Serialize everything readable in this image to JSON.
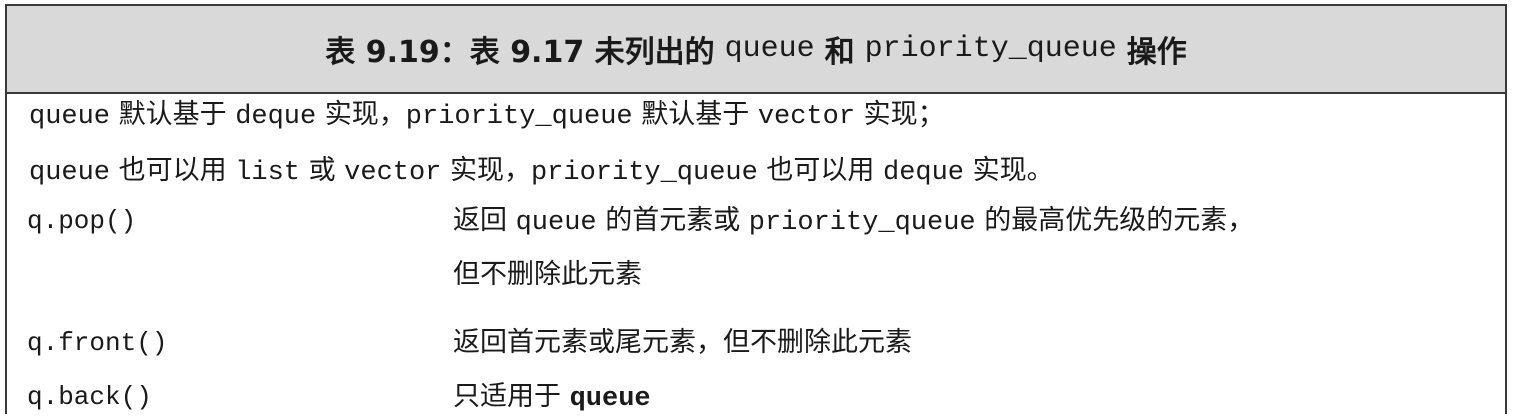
{
  "table": {
    "title": {
      "prefix": "表 9.19：表 9.17 未列出的",
      "code1": "queue",
      "join": "和",
      "code2": "priority_queue",
      "suffix": "操作"
    },
    "notes": [
      {
        "parts": [
          "queue",
          " 默认基于 ",
          "deque",
          " 实现，",
          "priority_queue",
          " 默认基于 ",
          "vector",
          " 实现；"
        ]
      },
      {
        "parts": [
          "queue",
          " 也可以用 ",
          "list",
          " 或 ",
          "vector",
          " 实现，",
          "priority_queue",
          " 也可以用 ",
          "deque",
          " 实现。"
        ]
      }
    ],
    "rows": [
      {
        "op": "q.pop()",
        "desc_line1_a": "返回 ",
        "desc_line1_code1": "queue",
        "desc_line1_b": " 的首元素或 ",
        "desc_line1_code2": "priority_queue",
        "desc_line1_c": " 的最高优先级的元素，",
        "desc_line2": "但不删除此元素"
      },
      {
        "op": "q.front()",
        "desc": "返回首元素或尾元素，但不删除此元素"
      },
      {
        "op": "q.back()",
        "desc_a": "只适用于 ",
        "desc_code": "queue"
      }
    ]
  }
}
